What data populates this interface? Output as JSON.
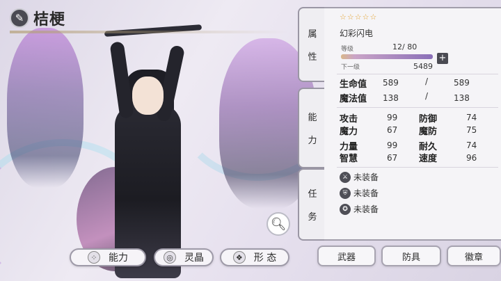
{
  "character": {
    "name": "桔梗",
    "stars": "☆☆☆☆☆",
    "job": "幻彩闪电"
  },
  "level": {
    "label": "等级",
    "value": "12/ 80",
    "next_label": "下一级",
    "next_value": "5489",
    "progress": 0.15
  },
  "vitals": {
    "hp_label": "生命值",
    "hp_current": "589",
    "hp_max": "589",
    "mp_label": "魔法值",
    "mp_current": "138",
    "mp_max": "138",
    "slash": "/"
  },
  "stats": [
    {
      "label": "攻击",
      "value": "99"
    },
    {
      "label": "防御",
      "value": "74"
    },
    {
      "label": "魔力",
      "value": "67"
    },
    {
      "label": "魔防",
      "value": "75"
    },
    {
      "label": "力量",
      "value": "99"
    },
    {
      "label": "耐久",
      "value": "74"
    },
    {
      "label": "智慧",
      "value": "67"
    },
    {
      "label": "速度",
      "value": "96"
    }
  ],
  "equipment": [
    {
      "label": "未装备",
      "icon": "sword-icon"
    },
    {
      "label": "未装备",
      "icon": "armor-icon"
    },
    {
      "label": "未装备",
      "icon": "badge-icon"
    }
  ],
  "tabs": {
    "attr": [
      "属",
      "性"
    ],
    "ability": [
      "能",
      "力"
    ],
    "task": [
      "任",
      "务"
    ]
  },
  "bottom_buttons": {
    "ability": "能力",
    "crystal": "灵晶",
    "form": "形 态"
  },
  "slot_buttons": {
    "weapon": "武器",
    "armor": "防具",
    "badge": "徽章"
  },
  "colors": {
    "accent_gold": "#e3a12e",
    "panel_bg": "#f5f4f7",
    "border": "#9a96a4"
  }
}
